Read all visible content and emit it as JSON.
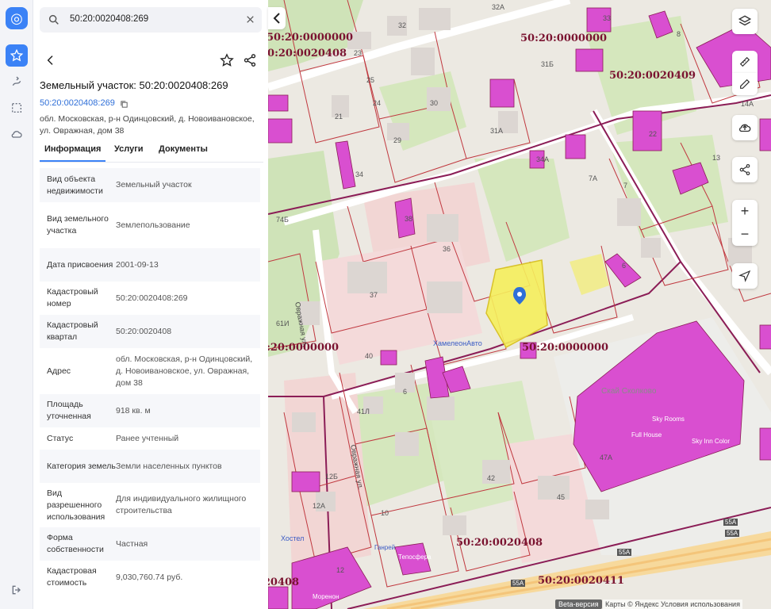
{
  "search": {
    "value": "50:20:0020408:269"
  },
  "card": {
    "title": "Земельный участок: 50:20:0020408:269",
    "cad_link": "50:20:0020408:269",
    "address": "обл. Московская, р-н Одинцовский, д. Новоивановское, ул. Овражная, дом 38"
  },
  "tabs": [
    {
      "label": "Информация"
    },
    {
      "label": "Услуги"
    },
    {
      "label": "Документы"
    }
  ],
  "info": [
    {
      "key": "Вид объекта недвижимости",
      "value": "Земельный участок"
    },
    {
      "key": "Вид земельного участка",
      "value": "Землепользование"
    },
    {
      "key": "Дата присвоения",
      "value": "2001-09-13"
    },
    {
      "key": "Кадастровый номер",
      "value": "50:20:0020408:269"
    },
    {
      "key": "Кадастровый квартал",
      "value": "50:20:0020408"
    },
    {
      "key": "Адрес",
      "value": "обл. Московская, р-н Одинцовский, д. Новоивановское, ул. Овражная, дом 38"
    },
    {
      "key": "Площадь уточненная",
      "value": "918 кв. м"
    },
    {
      "key": "Статус",
      "value": "Ранее учтенный"
    },
    {
      "key": "Категория земель",
      "value": "Земли населенных пунктов"
    },
    {
      "key": "Вид разрешенного использования",
      "value": "Для индивидуального жилищного строительства"
    },
    {
      "key": "Форма собственности",
      "value": "Частная"
    },
    {
      "key": "Кадастровая стоимость",
      "value": "9,030,760.74 руб."
    }
  ],
  "map": {
    "quarters": [
      "50:20:0000000",
      "50:20:0020408",
      "50:20:0020409",
      "50:20:0000000",
      "50:20:0000000",
      "50:20:0020408",
      "50:20:0020411",
      "50:20:0020408"
    ],
    "streets": [
      "Овражная ул.",
      "Овражная ул."
    ],
    "houses": [
      "32",
      "32А",
      "33",
      "8",
      "23",
      "31Б",
      "25",
      "24",
      "30",
      "21",
      "29",
      "31А",
      "14А",
      "22",
      "34А",
      "34",
      "13",
      "7А",
      "7",
      "74Б",
      "38",
      "36",
      "37",
      "6",
      "61И",
      "40",
      "6",
      "41Л",
      "42",
      "12Б",
      "12А",
      "10",
      "45",
      "47А",
      "12"
    ],
    "pois": [
      "ХамелеонАвто",
      "Скай Сколково",
      "Sky Rooms",
      "Full House",
      "Sky Inn Color",
      "Хостел",
      "Ганрей",
      "Тепосфера",
      "Моренон"
    ],
    "road_shields": [
      "55А",
      "55А",
      "55А",
      "55А"
    ],
    "beta": "Beta-версия",
    "attribution": "Карты © Яндекс  Условия использования"
  },
  "colors": {
    "accent": "#3b82f6",
    "parcel_border": "#c0383f",
    "building": "#d94fd0",
    "selected": "#f7ef5c"
  }
}
